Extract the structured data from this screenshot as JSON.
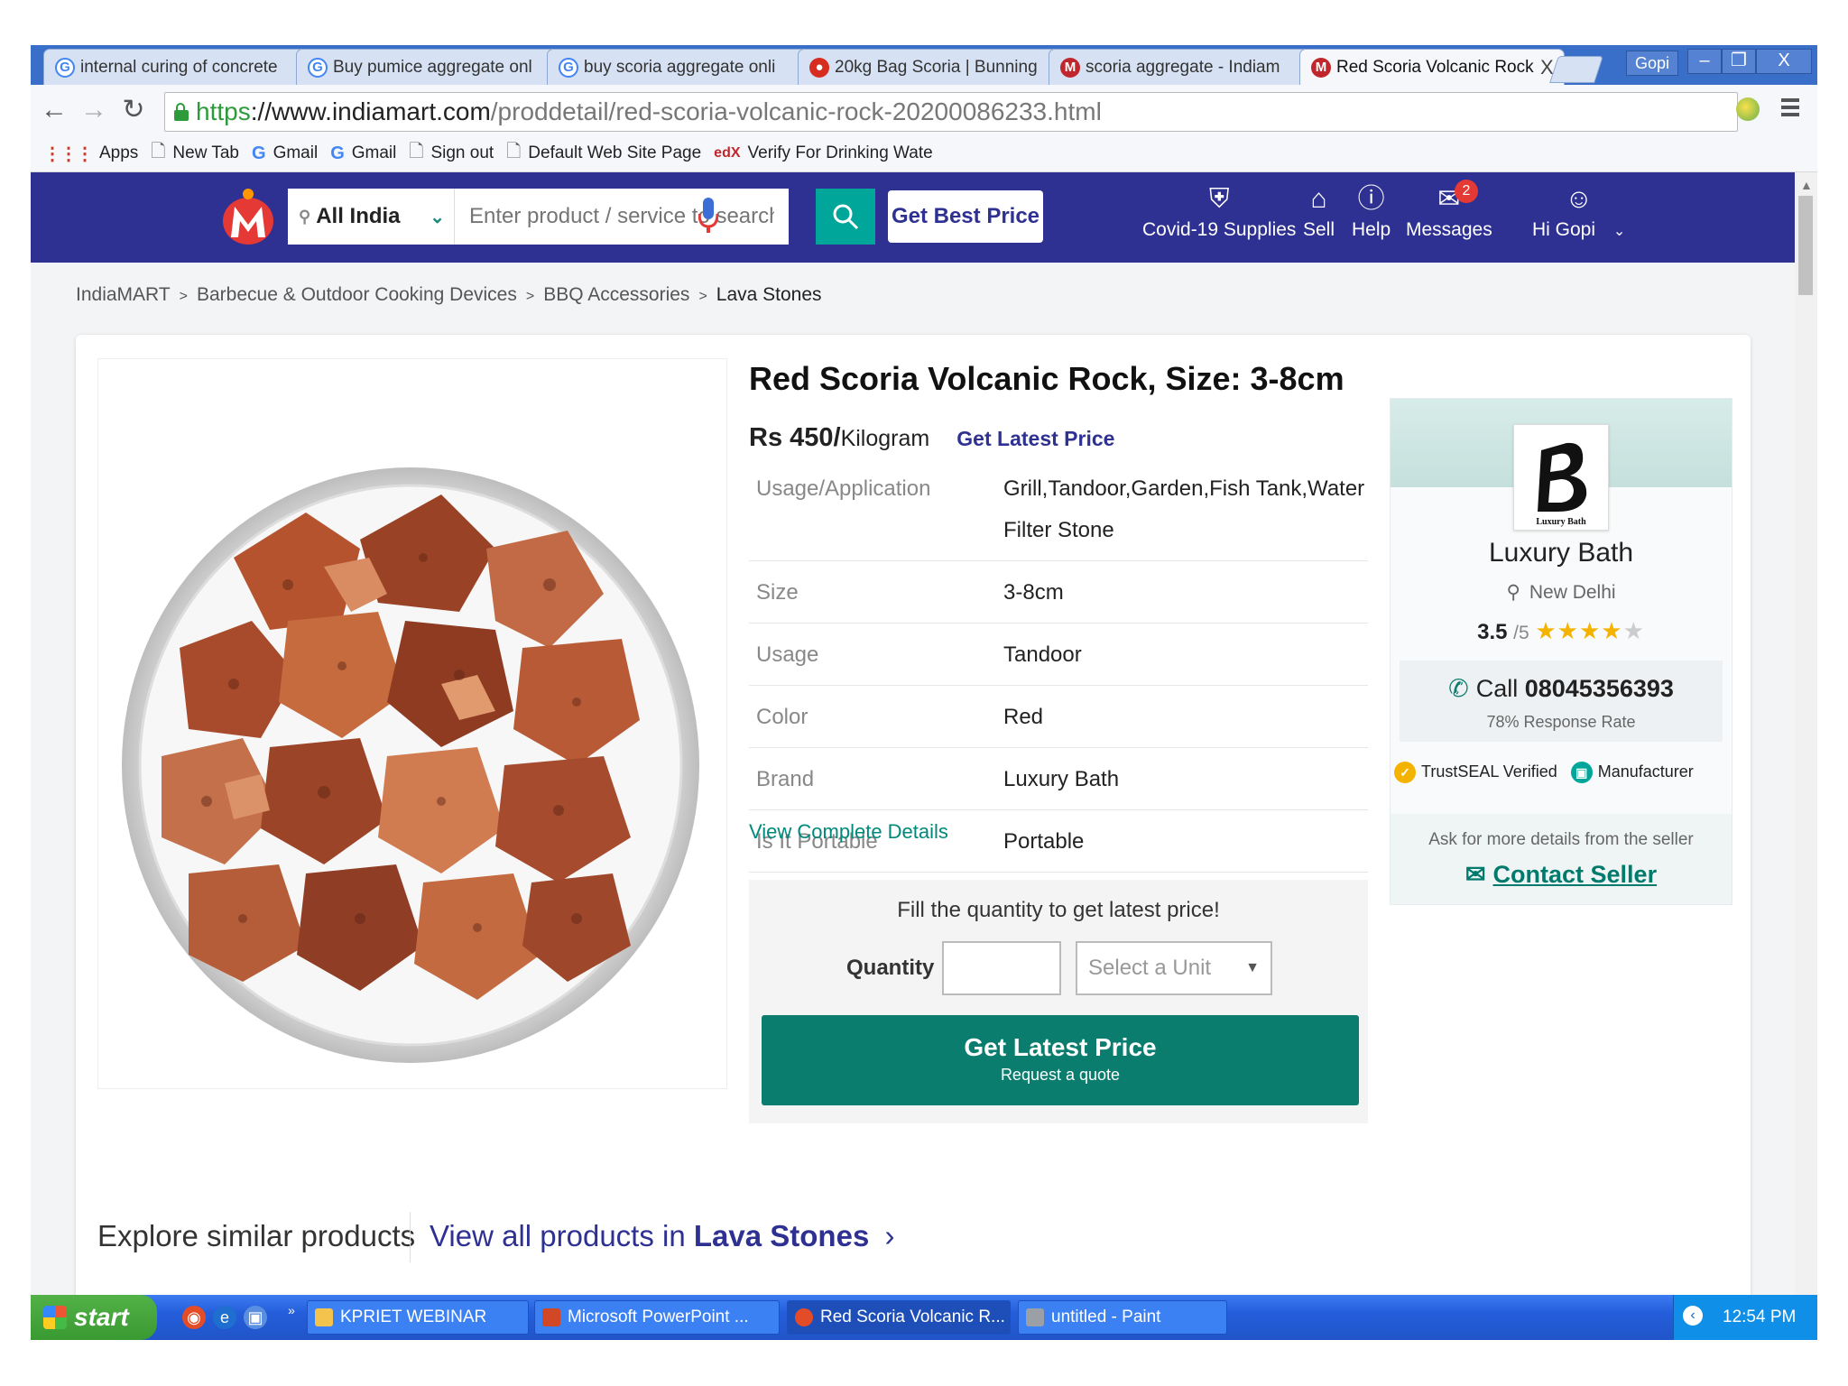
{
  "browser": {
    "tabs": [
      {
        "label": "internal curing of concrete",
        "icon": "google-icon"
      },
      {
        "label": "Buy pumice aggregate onl",
        "icon": "google-icon"
      },
      {
        "label": "buy scoria aggregate onli",
        "icon": "google-icon"
      },
      {
        "label": "20kg Bag Scoria | Bunning",
        "icon": "bunnings-icon"
      },
      {
        "label": "scoria aggregate - Indiam",
        "icon": "indiamart-icon"
      },
      {
        "label": "Red Scoria Volcanic Rock,",
        "icon": "indiamart-icon",
        "active": true
      }
    ],
    "tab_close": "X",
    "user_chip": "Gopi",
    "window_controls": {
      "minimize": "–",
      "restore": "❐",
      "close": "X"
    },
    "url": {
      "scheme": "https",
      "host": "://www.indiamart.com",
      "path": "/proddetail/red-scoria-volcanic-rock-20200086233.html"
    },
    "bookmarks": [
      {
        "label": "Apps",
        "icon": "apps-grid-icon"
      },
      {
        "label": "New Tab",
        "icon": "page-icon"
      },
      {
        "label": "Gmail",
        "icon": "google-icon"
      },
      {
        "label": "Gmail",
        "icon": "google-icon"
      },
      {
        "label": "Sign out",
        "icon": "page-icon"
      },
      {
        "label": "Default Web Site Page",
        "icon": "page-icon"
      },
      {
        "label": "Verify For Drinking Wate",
        "icon": "edx-icon"
      }
    ]
  },
  "header": {
    "location": "All India",
    "search_placeholder": "Enter product / service to search",
    "get_best_price": "Get Best Price",
    "nav": {
      "covid": "Covid-19 Supplies",
      "sell": "Sell",
      "help": "Help",
      "messages": "Messages",
      "messages_badge": "2",
      "user": "Hi Gopi"
    }
  },
  "breadcrumb": [
    "IndiaMART",
    "Barbecue & Outdoor Cooking Devices",
    "BBQ Accessories",
    "Lava Stones"
  ],
  "breadcrumb_sep": ">",
  "product": {
    "title": "Red Scoria Volcanic Rock, Size: 3-8cm",
    "price": "Rs 450/",
    "price_unit": "Kilogram",
    "get_latest_price": "Get Latest Price",
    "specs": [
      {
        "key": "Usage/Application",
        "value": "Grill,Tandoor,Garden,Fish Tank,Water Filter Stone"
      },
      {
        "key": "Size",
        "value": "3-8cm"
      },
      {
        "key": "Usage",
        "value": "Tandoor"
      },
      {
        "key": "Color",
        "value": "Red"
      },
      {
        "key": "Brand",
        "value": "Luxury Bath"
      },
      {
        "key": "Is It Portable",
        "value": "Portable"
      }
    ],
    "view_complete_details": "View Complete Details",
    "quantity_prompt": "Fill the quantity to get latest price!",
    "quantity_label": "Quantity",
    "unit_placeholder": "Select a Unit",
    "cta_main": "Get Latest Price",
    "cta_sub": "Request a quote"
  },
  "seller": {
    "logo_text": "Luxury Bath",
    "name": "Luxury Bath",
    "city": "New Delhi",
    "rating": "3.5",
    "rating_outof": "/5",
    "stars": 3.5,
    "call_label": "Call",
    "phone": "08045356393",
    "response_rate": "78% Response Rate",
    "trustseal": "TrustSEAL Verified",
    "manufacturer": "Manufacturer",
    "ask": "Ask for more details from the seller",
    "contact": "Contact Seller"
  },
  "explore": {
    "title": "Explore similar products",
    "view_all_prefix": "View all products in",
    "view_all_category": "Lava Stones",
    "chevron": "›"
  },
  "taskbar": {
    "start": "start",
    "tasks": [
      {
        "label": "KPRIET WEBINAR",
        "icon": "folder-icon"
      },
      {
        "label": "Microsoft PowerPoint ...",
        "icon": "powerpoint-icon"
      },
      {
        "label": "Red Scoria Volcanic R...",
        "icon": "chrome-icon",
        "active": true
      },
      {
        "label": "untitled - Paint",
        "icon": "paint-icon"
      }
    ],
    "clock": "12:54 PM"
  },
  "colors": {
    "indiamart_blue": "#2e3192",
    "teal": "#00a699",
    "cta_green": "#0a7d6e",
    "xp_blue": "#245edb"
  }
}
